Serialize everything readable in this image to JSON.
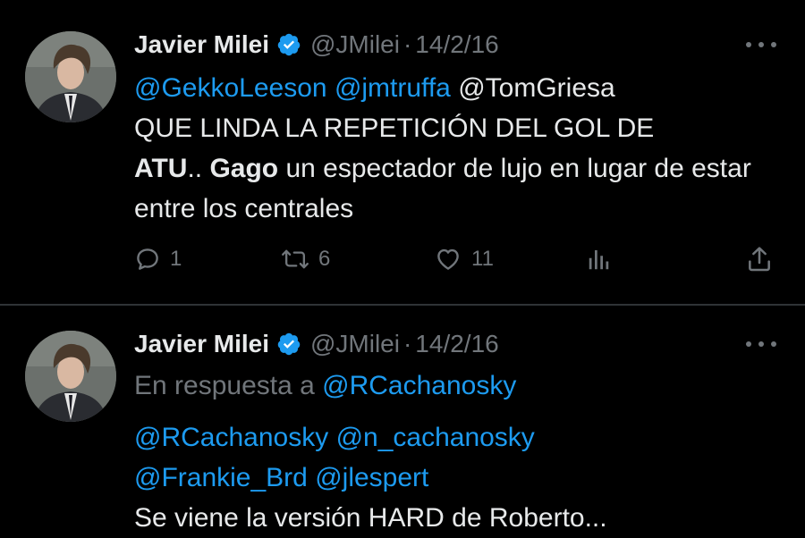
{
  "tweets": [
    {
      "author": "Javier Milei",
      "handle": "@JMilei",
      "separator": "·",
      "date": "14/2/16",
      "mentions_blue": [
        "@GekkoLeeson",
        "@jmtruffa"
      ],
      "mention_plain": "@TomGriesa",
      "text_line1": "QUE LINDA LA REPETICIÓN DEL GOL DE",
      "bold1": "ATU",
      "mid1": ".. ",
      "bold2": "Gago",
      "rest": " un espectador de lujo en lugar de estar entre los centrales",
      "reply_count": "1",
      "retweet_count": "6",
      "like_count": "11"
    },
    {
      "author": "Javier Milei",
      "handle": "@JMilei",
      "separator": "·",
      "date": "14/2/16",
      "reply_prefix": "En respuesta a ",
      "reply_target": "@RCachanosky",
      "mentions": [
        "@RCachanosky",
        "@n_cachanosky",
        "@Frankie_Brd",
        "@jlespert"
      ],
      "body": "Se viene la versión HARD de Roberto..."
    }
  ],
  "colors": {
    "background": "#000000",
    "text": "#e7e9ea",
    "secondary": "#71767b",
    "link": "#1d9bf0",
    "verified": "#1d9bf0",
    "divider": "#2f3336"
  },
  "icons": [
    "verified-badge-icon",
    "more-icon",
    "reply-icon",
    "retweet-icon",
    "like-icon",
    "views-icon",
    "share-icon"
  ]
}
